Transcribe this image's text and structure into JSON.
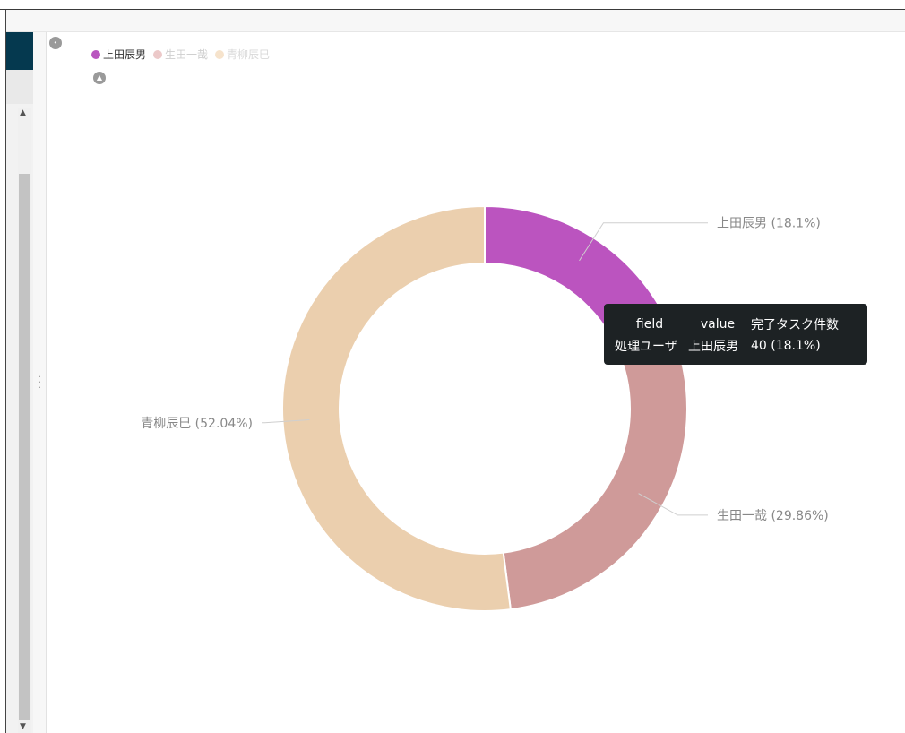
{
  "legend": {
    "items": [
      {
        "label": "上田辰男",
        "color": "#b956bf",
        "active": true
      },
      {
        "label": "生田一哉",
        "color": "#e8c5c5",
        "active": false
      },
      {
        "label": "青柳辰巳",
        "color": "#f6e3cc",
        "active": false
      }
    ]
  },
  "tooltip": {
    "headers": [
      "field",
      "value",
      "完了タスク件数"
    ],
    "row": [
      "処理ユーザ",
      "上田辰男",
      "40 (18.1%)"
    ]
  },
  "chart_data": {
    "type": "pie",
    "donut": true,
    "labels": [
      "上田辰男",
      "生田一哉",
      "青柳辰巳"
    ],
    "values": [
      18.1,
      29.86,
      52.04
    ],
    "percent_labels": [
      "上田辰男 (18.1%)",
      "生田一哉 (29.86%)",
      "青柳辰巳 (52.04%)"
    ],
    "colors": [
      "#bb54bf",
      "#cf9a99",
      "#ebcfae"
    ],
    "legend_position": "top-left"
  }
}
